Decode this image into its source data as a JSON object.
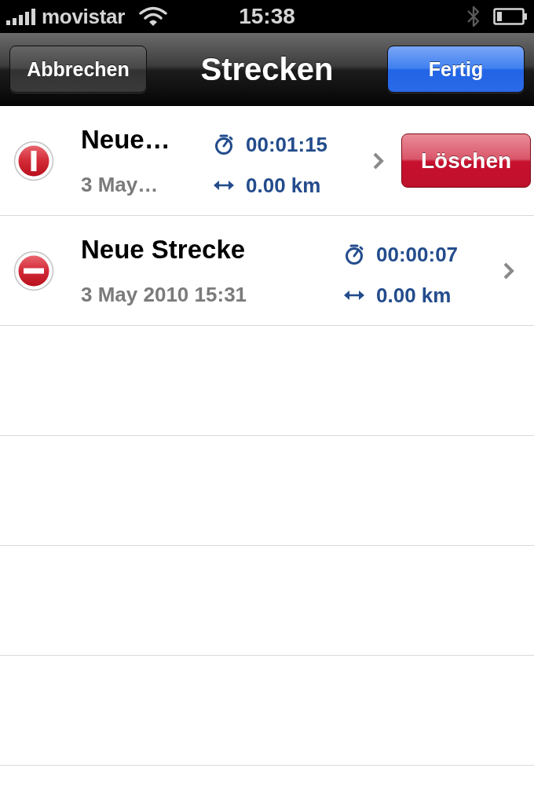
{
  "status_bar": {
    "carrier": "movistar",
    "time": "15:38"
  },
  "nav_bar": {
    "left_button": "Abbrechen",
    "title": "Strecken",
    "right_button": "Fertig"
  },
  "rows": [
    {
      "title": "Neue…",
      "date": "3 May…",
      "duration": "00:01:15",
      "distance": "0.00 km",
      "delete_confirming": true,
      "delete_button": "Löschen"
    },
    {
      "title": "Neue Strecke",
      "date": "3 May 2010 15:31",
      "duration": "00:00:07",
      "distance": "0.00 km",
      "delete_confirming": false
    }
  ]
}
